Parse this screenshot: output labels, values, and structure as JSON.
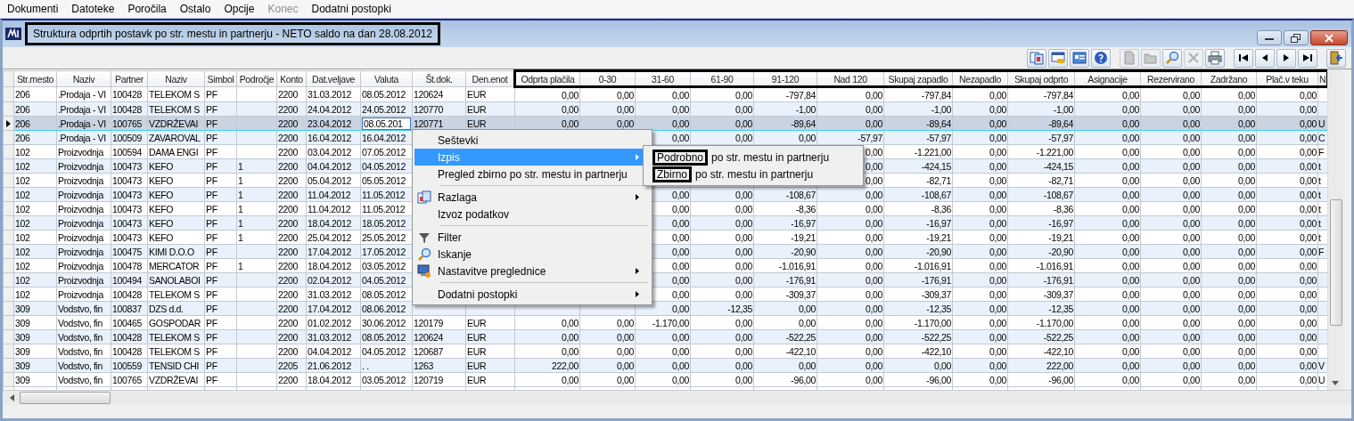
{
  "menubar": [
    {
      "label": "Dokumenti",
      "disabled": false
    },
    {
      "label": "Datoteke",
      "disabled": false
    },
    {
      "label": "Poročila",
      "disabled": false
    },
    {
      "label": "Ostalo",
      "disabled": false
    },
    {
      "label": "Opcije",
      "disabled": false
    },
    {
      "label": "Konec",
      "disabled": true
    },
    {
      "label": "Dodatni postopki",
      "disabled": false
    }
  ],
  "window": {
    "title": "Struktura odprtih postavk po str. mestu in partnerju   - NETO saldo  na dan 28.08.2012",
    "highlighted": true
  },
  "toolbar": [
    {
      "kind": "windows",
      "disabled": false
    },
    {
      "kind": "list",
      "disabled": false
    },
    {
      "kind": "card",
      "disabled": false
    },
    {
      "kind": "help",
      "disabled": false
    },
    {
      "kind": "new",
      "disabled": true
    },
    {
      "kind": "open",
      "disabled": true
    },
    {
      "kind": "search",
      "disabled": false
    },
    {
      "kind": "delete",
      "disabled": true
    },
    {
      "kind": "print",
      "disabled": false
    },
    {
      "kind": "first",
      "disabled": false
    },
    {
      "kind": "prev",
      "disabled": false
    },
    {
      "kind": "next",
      "disabled": false
    },
    {
      "kind": "last",
      "disabled": false
    },
    {
      "kind": "exit",
      "disabled": false
    }
  ],
  "table": {
    "columns": [
      {
        "label": "Str.mesto",
        "kind": "text",
        "highlighted": false
      },
      {
        "label": "Naziv",
        "kind": "text",
        "highlighted": false
      },
      {
        "label": "Partner",
        "kind": "text",
        "highlighted": false
      },
      {
        "label": "Naziv",
        "kind": "text",
        "highlighted": false
      },
      {
        "label": "Simbol",
        "kind": "text",
        "highlighted": false
      },
      {
        "label": "Področje",
        "kind": "text",
        "highlighted": false
      },
      {
        "label": "Konto",
        "kind": "text",
        "highlighted": false
      },
      {
        "label": "Dat.veljave",
        "kind": "text",
        "highlighted": false
      },
      {
        "label": "Valuta",
        "kind": "text",
        "highlighted": false
      },
      {
        "label": "Št.dok.",
        "kind": "text",
        "highlighted": false
      },
      {
        "label": "Den.enot",
        "kind": "text",
        "highlighted": false
      },
      {
        "label": "Odprta plačila",
        "kind": "amount",
        "highlighted": true
      },
      {
        "label": "0-30",
        "kind": "amount",
        "highlighted": true
      },
      {
        "label": "31-60",
        "kind": "amount",
        "highlighted": true
      },
      {
        "label": "61-90",
        "kind": "amount",
        "highlighted": true
      },
      {
        "label": "91-120",
        "kind": "amount",
        "highlighted": true
      },
      {
        "label": "Nad 120",
        "kind": "amount",
        "highlighted": true
      },
      {
        "label": "Skupaj zapadlo",
        "kind": "amount",
        "highlighted": true
      },
      {
        "label": "Nezapadlo",
        "kind": "amount",
        "highlighted": true
      },
      {
        "label": "Skupaj odprto",
        "kind": "amount",
        "highlighted": true
      },
      {
        "label": "Asignacije",
        "kind": "amount",
        "highlighted": true
      },
      {
        "label": "Rezervirano",
        "kind": "amount",
        "highlighted": true
      },
      {
        "label": "Zadržano",
        "kind": "amount",
        "highlighted": true
      },
      {
        "label": "Plač.v teku",
        "kind": "amount",
        "highlighted": true
      },
      {
        "label": "N",
        "kind": "text",
        "highlighted": true
      }
    ],
    "rows": [
      {
        "selected": false,
        "cells": [
          "206",
          ".Prodaja - VI",
          "100428",
          "TELEKOM S",
          "PF",
          null,
          "2200",
          "31.03.2012",
          "08.05.2012",
          "120624",
          "EUR",
          "0,00",
          "0,00",
          "0,00",
          "0,00",
          "-797,84",
          "0,00",
          "-797,84",
          "0,00",
          "-797,84",
          "0,00",
          "0,00",
          "0,00",
          "0,00",
          null
        ]
      },
      {
        "selected": false,
        "cells": [
          "206",
          ".Prodaja - VI",
          "100428",
          "TELEKOM S",
          "PF",
          null,
          "2200",
          "24.04.2012",
          "24.05.2012",
          "120770",
          "EUR",
          "0,00",
          "0,00",
          "0,00",
          "0,00",
          "-1,00",
          "0,00",
          "-1,00",
          "0,00",
          "-1,00",
          "0,00",
          "0,00",
          "0,00",
          "0,00",
          null
        ]
      },
      {
        "selected": true,
        "cells": [
          "206",
          ".Prodaja - VI",
          "100765",
          "VZDRŽEVAI",
          "PF",
          null,
          "2200",
          "23.04.2012",
          {
            "kind": "editor",
            "value": "08.05.201"
          },
          "120771",
          "EUR",
          "0,00",
          "0,00",
          "0,00",
          "0,00",
          "-89,64",
          "0,00",
          "-89,64",
          "0,00",
          "-89,64",
          "0,00",
          "0,00",
          "0,00",
          "0,00",
          "U"
        ]
      },
      {
        "selected": false,
        "cells": [
          "206",
          ".Prodaja - VI",
          "100509",
          "ZAVAROVAL",
          "PF",
          null,
          "2200",
          "16.04.2012",
          "16.04.2012",
          null,
          null,
          null,
          null,
          "0,00",
          "0,00",
          "0,00",
          "-57,97",
          "-57,97",
          "0,00",
          "-57,97",
          "0,00",
          "0,00",
          "0,00",
          "0,00",
          "C"
        ]
      },
      {
        "selected": false,
        "cells": [
          "102",
          "Proizvodnja",
          "100594",
          "DAMA ENGI",
          "PF",
          null,
          "2200",
          "03.04.2012",
          "07.05.2012",
          null,
          null,
          null,
          null,
          null,
          null,
          null,
          "0,00",
          "-1.221,00",
          "0,00",
          "-1.221,00",
          "0,00",
          "0,00",
          "0,00",
          "0,00",
          "F"
        ]
      },
      {
        "selected": false,
        "cells": [
          "102",
          "Proizvodnja",
          "100473",
          "KEFO",
          "PF",
          "1",
          "2200",
          "04.04.2012",
          "04.05.2012",
          null,
          null,
          null,
          null,
          null,
          null,
          null,
          "0,00",
          "-424,15",
          "0,00",
          "-424,15",
          "0,00",
          "0,00",
          "0,00",
          "0,00",
          "t"
        ]
      },
      {
        "selected": false,
        "cells": [
          "102",
          "Proizvodnja",
          "100473",
          "KEFO",
          "PF",
          "1",
          "2200",
          "05.04.2012",
          "05.05.2012",
          null,
          null,
          null,
          null,
          null,
          null,
          null,
          "0,00",
          "-82,71",
          "0,00",
          "-82,71",
          "0,00",
          "0,00",
          "0,00",
          "0,00",
          "t"
        ]
      },
      {
        "selected": false,
        "cells": [
          "102",
          "Proizvodnja",
          "100473",
          "KEFO",
          "PF",
          "1",
          "2200",
          "11.04.2012",
          "11.05.2012",
          null,
          null,
          null,
          null,
          "0,00",
          "0,00",
          "-108,67",
          "0,00",
          "-108,67",
          "0,00",
          "-108,67",
          "0,00",
          "0,00",
          "0,00",
          "0,00",
          "t"
        ]
      },
      {
        "selected": false,
        "cells": [
          "102",
          "Proizvodnja",
          "100473",
          "KEFO",
          "PF",
          "1",
          "2200",
          "11.04.2012",
          "11.05.2012",
          null,
          null,
          null,
          null,
          "0,00",
          "0,00",
          "-8,36",
          "0,00",
          "-8,36",
          "0,00",
          "-8,36",
          "0,00",
          "0,00",
          "0,00",
          "0,00",
          "t"
        ]
      },
      {
        "selected": false,
        "cells": [
          "102",
          "Proizvodnja",
          "100473",
          "KEFO",
          "PF",
          "1",
          "2200",
          "18.04.2012",
          "18.05.2012",
          null,
          null,
          null,
          null,
          "0,00",
          "0,00",
          "-16,97",
          "0,00",
          "-16,97",
          "0,00",
          "-16,97",
          "0,00",
          "0,00",
          "0,00",
          "0,00",
          "t"
        ]
      },
      {
        "selected": false,
        "cells": [
          "102",
          "Proizvodnja",
          "100473",
          "KEFO",
          "PF",
          "1",
          "2200",
          "25.04.2012",
          "25.05.2012",
          null,
          null,
          null,
          null,
          "0,00",
          "0,00",
          "-19,21",
          "0,00",
          "-19,21",
          "0,00",
          "-19,21",
          "0,00",
          "0,00",
          "0,00",
          "0,00",
          "t"
        ]
      },
      {
        "selected": false,
        "cells": [
          "102",
          "Proizvodnja",
          "100475",
          "KIMI D.O.O",
          "PF",
          null,
          "2200",
          "17.04.2012",
          "17.05.2012",
          null,
          null,
          null,
          null,
          "0,00",
          "0,00",
          "-20,90",
          "0,00",
          "-20,90",
          "0,00",
          "-20,90",
          "0,00",
          "0,00",
          "0,00",
          "0,00",
          "F"
        ]
      },
      {
        "selected": false,
        "cells": [
          "102",
          "Proizvodnja",
          "100478",
          "MERCATOR",
          "PF",
          "1",
          "2200",
          "18.04.2012",
          "03.05.2012",
          null,
          null,
          null,
          null,
          "0,00",
          "0,00",
          "-1.016,91",
          "0,00",
          "-1.016,91",
          "0,00",
          "-1.016,91",
          "0,00",
          "0,00",
          "0,00",
          "0,00",
          null
        ]
      },
      {
        "selected": false,
        "cells": [
          "102",
          "Proizvodnja",
          "100494",
          "SANOLABOI",
          "PF",
          null,
          "2200",
          "02.04.2012",
          "04.05.2012",
          null,
          null,
          null,
          null,
          "0,00",
          "0,00",
          "-176,91",
          "0,00",
          "-176,91",
          "0,00",
          "-176,91",
          "0,00",
          "0,00",
          "0,00",
          "0,00",
          null
        ]
      },
      {
        "selected": false,
        "cells": [
          "102",
          "Proizvodnja",
          "100428",
          "TELEKOM S",
          "PF",
          null,
          "2200",
          "31.03.2012",
          "08.05.2012",
          null,
          null,
          null,
          null,
          "0,00",
          "0,00",
          "-309,37",
          "0,00",
          "-309,37",
          "0,00",
          "-309,37",
          "0,00",
          "0,00",
          "0,00",
          "0,00",
          null
        ]
      },
      {
        "selected": false,
        "cells": [
          "309",
          "Vodstvo, fin",
          "100837",
          "DZS d.d.",
          "PF",
          null,
          "2200",
          "17.04.2012",
          "08.06.2012",
          null,
          null,
          null,
          null,
          "0,00",
          "-12,35",
          "0,00",
          "0,00",
          "-12,35",
          "0,00",
          "-12,35",
          "0,00",
          "0,00",
          "0,00",
          "0,00",
          null
        ]
      },
      {
        "selected": false,
        "cells": [
          "309",
          "Vodstvo, fin",
          "100465",
          "GOSPODAR",
          "PF",
          null,
          "2200",
          "01.02.2012",
          "30.06.2012",
          "120179",
          "EUR",
          "0,00",
          "0,00",
          "-1.170,00",
          "0,00",
          "0,00",
          "0,00",
          "-1.170,00",
          "0,00",
          "-1.170,00",
          "0,00",
          "0,00",
          "0,00",
          "0,00",
          null
        ]
      },
      {
        "selected": false,
        "cells": [
          "309",
          "Vodstvo, fin",
          "100428",
          "TELEKOM S",
          "PF",
          null,
          "2200",
          "31.03.2012",
          "08.05.2012",
          "120624",
          "EUR",
          "0,00",
          "0,00",
          "0,00",
          "0,00",
          "-522,25",
          "0,00",
          "-522,25",
          "0,00",
          "-522,25",
          "0,00",
          "0,00",
          "0,00",
          "0,00",
          null
        ]
      },
      {
        "selected": false,
        "cells": [
          "309",
          "Vodstvo, fin",
          "100428",
          "TELEKOM S",
          "PF",
          null,
          "2200",
          "04.04.2012",
          "04.05.2012",
          "120687",
          "EUR",
          "0,00",
          "0,00",
          "0,00",
          "0,00",
          "-422,10",
          "0,00",
          "-422,10",
          "0,00",
          "-422,10",
          "0,00",
          "0,00",
          "0,00",
          "0,00",
          null
        ]
      },
      {
        "selected": false,
        "cells": [
          "309",
          "Vodstvo, fin",
          "100559",
          "TENSID CHI",
          "PF",
          null,
          "2205",
          "21.06.2012",
          ". .",
          "1263",
          "EUR",
          "222,00",
          "0,00",
          "0,00",
          "0,00",
          "0,00",
          "0,00",
          "0,00",
          "0,00",
          "222,00",
          "0,00",
          "0,00",
          "0,00",
          "0,00",
          "V"
        ]
      },
      {
        "selected": false,
        "cells": [
          "309",
          "Vodstvo, fin",
          "100765",
          "VZDRŽEVAI",
          "PF",
          null,
          "2200",
          "18.04.2012",
          "03.05.2012",
          "120719",
          "EUR",
          "0,00",
          "0,00",
          "0,00",
          "0,00",
          "-96,00",
          "0,00",
          "-96,00",
          "0,00",
          "-96,00",
          "0,00",
          "0,00",
          "0,00",
          "0,00",
          "U"
        ]
      }
    ]
  },
  "context_menu": {
    "items": [
      {
        "kind": "plain",
        "label": "Seštevki",
        "selected": false,
        "has_submenu": false
      },
      {
        "kind": "plain",
        "label": "Izpis",
        "selected": true,
        "has_submenu": true
      },
      {
        "kind": "plain",
        "label": "Pregled zbirno po str. mestu in partnerju",
        "selected": false,
        "has_submenu": false
      },
      {
        "kind": "separator"
      },
      {
        "kind": "report",
        "label": "Razlaga",
        "selected": false,
        "has_submenu": true
      },
      {
        "kind": "plain",
        "label": "Izvoz podatkov",
        "selected": false,
        "has_submenu": false
      },
      {
        "kind": "separator"
      },
      {
        "kind": "filter",
        "label": "Filter",
        "selected": false,
        "has_submenu": false
      },
      {
        "kind": "search",
        "label": "Iskanje",
        "selected": false,
        "has_submenu": false
      },
      {
        "kind": "settings",
        "label": "Nastavitve preglednice",
        "selected": false,
        "has_submenu": true
      },
      {
        "kind": "separator"
      },
      {
        "kind": "plain",
        "label": "Dodatni postopki",
        "selected": false,
        "has_submenu": true
      }
    ],
    "submenu": [
      {
        "lead": "Podrobno",
        "rest": "po str. mestu in partnerju",
        "highlighted": true
      },
      {
        "lead": "Zbirno",
        "rest": "po str. mestu in partnerju",
        "highlighted": true
      }
    ]
  }
}
